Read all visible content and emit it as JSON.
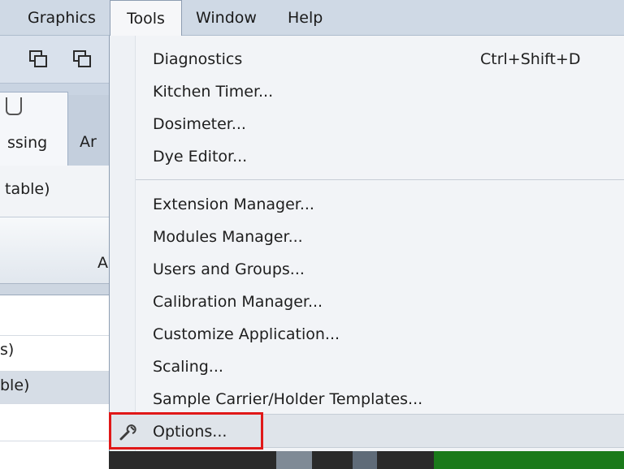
{
  "menubar": {
    "items": [
      {
        "label": "Graphics"
      },
      {
        "label": "Tools"
      },
      {
        "label": "Window"
      },
      {
        "label": "Help"
      }
    ]
  },
  "background": {
    "tabs": [
      {
        "label": "ssing"
      },
      {
        "label": "Ar"
      }
    ],
    "status_text": "table)",
    "header_text": "A",
    "rows": [
      {
        "label": ""
      },
      {
        "label": "s)"
      },
      {
        "label": "ble)"
      },
      {
        "label": ""
      }
    ]
  },
  "dropdown": {
    "groups": [
      [
        {
          "label": "Diagnostics",
          "shortcut": "Ctrl+Shift+D"
        },
        {
          "label": "Kitchen Timer..."
        },
        {
          "label": "Dosimeter..."
        },
        {
          "label": "Dye Editor..."
        }
      ],
      [
        {
          "label": "Extension Manager..."
        },
        {
          "label": "Modules Manager..."
        },
        {
          "label": "Users and Groups..."
        },
        {
          "label": "Calibration Manager..."
        },
        {
          "label": "Customize Application..."
        },
        {
          "label": "Scaling..."
        },
        {
          "label": "Sample Carrier/Holder Templates..."
        }
      ]
    ],
    "options": {
      "label": "Options...",
      "icon": "wrench-icon"
    }
  },
  "colors": {
    "menubar": "#cfd9e5",
    "dropdown_bg": "#f2f4f7",
    "highlight": "#e01818"
  }
}
